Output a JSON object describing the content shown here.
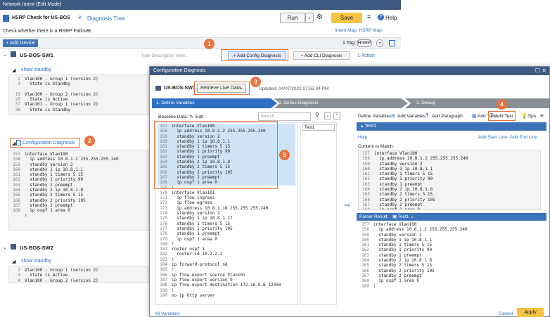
{
  "window": {
    "title": "Network Intent (Edit Mode)",
    "controls": "— ☐ ✕"
  },
  "intent": {
    "name": "HSRP Check for US-BOS",
    "diag_tree": "Diagnosis Tree",
    "description": "Check whether there is a HSRP Failover",
    "intent_map": "Intent Map: HSRP Map"
  },
  "actions": {
    "run": "Run",
    "save": "Save",
    "help": "Help",
    "add_device": "+ Add Device",
    "tag_label": "1 Tag:",
    "tag_value": "HSRP",
    "tag_plus": "+"
  },
  "device1": {
    "name": "US-BOS-SW1",
    "desc_placeholder": "Type Description here...",
    "add_config": "+ Add Config Diagnosis",
    "add_cli": "+ Add CLI Diagnosis",
    "action": "1 Action",
    "show_cmd": "show standby",
    "output": [
      {
        "n": "2",
        "t": "Vlan100 - Group 1 (version 2)"
      },
      {
        "n": "3",
        "t": "  State is Standby"
      },
      {
        "n": "",
        "t": ""
      },
      {
        "n": "19",
        "t": "Vlan100 - Group 2 (version 2)"
      },
      {
        "n": "20",
        "t": "  State is Active"
      },
      {
        "n": "37",
        "t": "Vlan101 - Group 1 (version 2)"
      },
      {
        "n": "38",
        "t": "  State is Standby"
      }
    ],
    "config_diag": "Configuration Diagnosis",
    "config": [
      {
        "n": "157",
        "t": "interface Vlan100"
      },
      {
        "n": "158",
        "t": "  ip address 10.8.1.2 255.255.255.240"
      },
      {
        "n": "159",
        "t": "  standby version 2"
      },
      {
        "n": "160",
        "t": "  standby 1 ip 10.8.1.1"
      },
      {
        "n": "161",
        "t": "  standby 1 timers 5 15"
      },
      {
        "n": "162",
        "t": "  standby 1 priority 90"
      },
      {
        "n": "163",
        "t": "  standby 1 preempt"
      },
      {
        "n": "164",
        "t": "  standby 2 ip 10.8.1.8"
      },
      {
        "n": "165",
        "t": "  standby 2 timers 5 15"
      },
      {
        "n": "166",
        "t": "  standby 2 priority 105"
      },
      {
        "n": "167",
        "t": "  standby 2 preempt"
      },
      {
        "n": "168",
        "t": "  ip ospf 1 area 0"
      },
      {
        "n": "",
        "t": "!"
      }
    ]
  },
  "device2": {
    "name": "US-BOS-SW2",
    "show_cmd": "show standby",
    "output": [
      {
        "n": "2",
        "t": "Vlan100 - Group 1 (version 2)"
      },
      {
        "n": "3",
        "t": "  State is Active"
      },
      {
        "n": "4",
        "t": "Vlan100 - Group 2 (version 2)"
      }
    ]
  },
  "dialog": {
    "title": "Configuration Diagnosis",
    "device": "US-BOS-SW1",
    "retrieve": "Retrieve Live Data",
    "updated": "Updated: 04/07/2022 07:55:04 PM",
    "steps": [
      "1. Define Variables",
      "2. Define Diagnosis",
      "3. Debug"
    ],
    "baseline_label": "Baseline Data:",
    "edit": "Edit",
    "search_placeholder": "Search...",
    "text_tag": "Text1",
    "baseline": [
      {
        "n": "157",
        "t": "interface Vlan100",
        "h": true
      },
      {
        "n": "158",
        "t": "  ip address 10.8.1.2 255.255.255.240",
        "h": true
      },
      {
        "n": "159",
        "t": "  standby version 2",
        "h": true
      },
      {
        "n": "160",
        "t": "  standby 1 ip 10.8.1.1",
        "h": true
      },
      {
        "n": "161",
        "t": "  standby 1 timers 5 15",
        "h": true
      },
      {
        "n": "162",
        "t": "  standby 1 priority 90",
        "h": true
      },
      {
        "n": "163",
        "t": "  standby 1 preempt",
        "h": true
      },
      {
        "n": "164",
        "t": "  standby 2 ip 10.8.1.8",
        "h": true
      },
      {
        "n": "165",
        "t": "  standby 2 timers 5 15",
        "h": true
      },
      {
        "n": "166",
        "t": "  standby 2 priority 105",
        "h": true
      },
      {
        "n": "167",
        "t": "  standby 2 preempt",
        "h": true
      },
      {
        "n": "168",
        "t": "  ip ospf 1 area 0",
        "h": true
      },
      {
        "n": "169",
        "t": "!",
        "h": false
      },
      {
        "n": "170",
        "t": "interface Vlan101",
        "h": false
      },
      {
        "n": "171",
        "t": "  ip flow ingress",
        "h": false
      },
      {
        "n": "172",
        "t": "  ip flow egress",
        "h": false
      },
      {
        "n": "173",
        "t": "  ip address 10.8.1.18 255.255.255.240",
        "h": false
      },
      {
        "n": "174",
        "t": "  standby version 2",
        "h": false
      },
      {
        "n": "175",
        "t": "  standby 1 ip 10.8.1.17",
        "h": false
      },
      {
        "n": "176",
        "t": "  standby 1 timers 5 15",
        "h": false
      },
      {
        "n": "177",
        "t": "  standby 1 priority 105",
        "h": false
      },
      {
        "n": "178",
        "t": "  standby 1 preempt",
        "h": false
      },
      {
        "n": "179",
        "t": "  ip ospf 1 area 0",
        "h": false
      },
      {
        "n": "180",
        "t": "!",
        "h": false
      },
      {
        "n": "181",
        "t": "router ospf 1",
        "h": false
      },
      {
        "n": "182",
        "t": "  router-id 10.2.2.2",
        "h": false
      },
      {
        "n": "183",
        "t": "!",
        "h": false
      },
      {
        "n": "184",
        "t": "ip forward-protocol nd",
        "h": false
      },
      {
        "n": "185",
        "t": "!",
        "h": false
      },
      {
        "n": "186",
        "t": "ip flow-export source Vlan101",
        "h": false
      },
      {
        "n": "187",
        "t": "ip flow-export version 9",
        "h": false
      },
      {
        "n": "188",
        "t": "ip flow-export destination 172.16.9.6 12350",
        "h": false
      },
      {
        "n": "189",
        "t": "!",
        "h": false
      },
      {
        "n": "190",
        "t": "no ip http server",
        "h": false
      }
    ],
    "all_variables": "All Variables",
    "right": {
      "define_vars": "Define Variables",
      "add_vars": "Add Variables",
      "add_para": "Add Paragraph",
      "add_table": "Add Table",
      "add_text": "Add Text",
      "tips": "Tips",
      "text1": "Text1",
      "help": "Help",
      "add_start": "Add Start Line",
      "add_end": "Add End Line",
      "content_match": "Content to Match:",
      "match": [
        {
          "n": "157",
          "t": "interface Vlan100"
        },
        {
          "n": "158",
          "t": "  ip address 10.8.1.2 255.255.255.240"
        },
        {
          "n": "159",
          "t": "  standby version 2"
        },
        {
          "n": "160",
          "t": "  standby 1 ip 10.8.1.1"
        },
        {
          "n": "161",
          "t": "  standby 1 timers 5 15"
        },
        {
          "n": "162",
          "t": "  standby 1 priority 90"
        },
        {
          "n": "163",
          "t": "  standby 1 preempt"
        },
        {
          "n": "164",
          "t": "  standby 2 ip 10.8.1.8"
        },
        {
          "n": "165",
          "t": "  standby 2 timers 5 15"
        },
        {
          "n": "166",
          "t": "  standby 2 priority 105"
        },
        {
          "n": "167",
          "t": "  standby 2 preempt"
        },
        {
          "n": "168",
          "t": "  ip ospf 1 area 0"
        }
      ],
      "parser_label": "Parser Result:",
      "parser_sel": "Text1",
      "parser": [
        {
          "n": "157",
          "t": "interface Vlan100"
        },
        {
          "n": "158",
          "t": "  ip address 10.8.1.2 255.255.255.240"
        },
        {
          "n": "159",
          "t": "  standby version 2"
        },
        {
          "n": "160",
          "t": "  standby 1 ip 10.8.1.1"
        },
        {
          "n": "161",
          "t": "  standby 1 timers 5 15"
        },
        {
          "n": "162",
          "t": "  standby 1 priority 90"
        },
        {
          "n": "163",
          "t": "  standby 1 preempt"
        },
        {
          "n": "164",
          "t": "  standby 2 ip 10.8.1.8"
        },
        {
          "n": "165",
          "t": "  standby 2 timers 5 15"
        },
        {
          "n": "166",
          "t": "  standby 2 priority 105"
        },
        {
          "n": "167",
          "t": "  standby 2 preempt"
        },
        {
          "n": "168",
          "t": "  ip ospf 1 area 0"
        },
        {
          "n": "169",
          "t": "!"
        }
      ]
    },
    "cancel": "Cancel",
    "apply": "Apply"
  },
  "callouts": [
    "1",
    "2",
    "3",
    "4",
    "5"
  ],
  "colors": {
    "title_bar": "#3d5a80",
    "accent_orange": "#e8743b",
    "save_yellow": "#f6c344",
    "apply_yellow": "#f6c344",
    "step_active": "#2f6fc4",
    "step_inactive": "#8a8f96",
    "highlight": "#cfe4f7"
  }
}
